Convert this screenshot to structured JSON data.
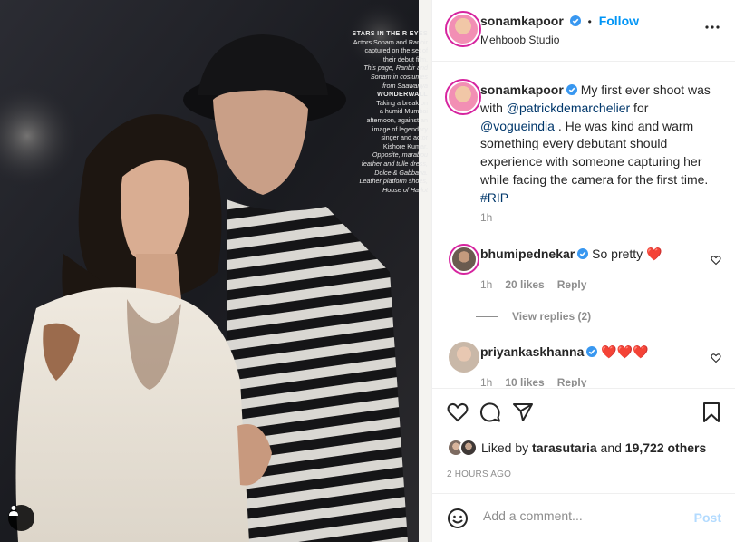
{
  "post": {
    "author": "sonamkapoor",
    "follow_label": "Follow",
    "location": "Mehboob Studio",
    "separator": "•",
    "photo_text": {
      "heading": "STARS IN THEIR EYES",
      "lines": [
        "Actors Sonam and Ranbir",
        "captured on the set of",
        "their debut film."
      ],
      "italic_lines": [
        "This page, Ranbir and",
        "Sonam in costumes",
        "from Saawariya"
      ],
      "heading2": "WONDERWALL",
      "lines2": [
        "Taking a break on",
        "a humid Mumbai",
        "afternoon, against an",
        "image of legendary",
        "singer and actor",
        "Kishore Kumar."
      ],
      "italic_lines2": [
        "Opposite, marabou",
        "feather and tulle dress,",
        "Dolce & Gabbana.",
        "Leather platform shoes,",
        "House of Harlot"
      ]
    }
  },
  "caption": {
    "username": "sonamkapoor",
    "text_1": " My first ever shoot was with ",
    "mention_1": "@patrickdemarchelier",
    "text_2": " for ",
    "mention_2": "@vogueindia",
    "text_3": " . He was kind and warm something every debutant should experience with someone capturing her while facing the camera for the first time. ",
    "hashtag": "#RIP",
    "time": "1h"
  },
  "comments": [
    {
      "username": "bhumipednekar",
      "text": "So pretty ",
      "emoji": "❤️",
      "time": "1h",
      "likes": "20 likes",
      "reply_label": "Reply",
      "view_replies": "View replies (2)"
    },
    {
      "username": "priyankaskhanna",
      "text": "",
      "emoji": "❤️❤️❤️",
      "time": "1h",
      "likes": "10 likes",
      "reply_label": "Reply"
    }
  ],
  "actions": {
    "liked_by_prefix": "Liked by ",
    "liked_by_user": "tarasutaria",
    "liked_by_and": " and ",
    "liked_by_others": "19,722 others",
    "timestamp": "2 HOURS AGO"
  },
  "add_comment": {
    "placeholder": "Add a comment...",
    "post_label": "Post"
  },
  "colors": {
    "accent": "#0095f6",
    "verified": "#3897f0",
    "heart": "#ed4956",
    "post_disabled": "#b3dbff"
  }
}
